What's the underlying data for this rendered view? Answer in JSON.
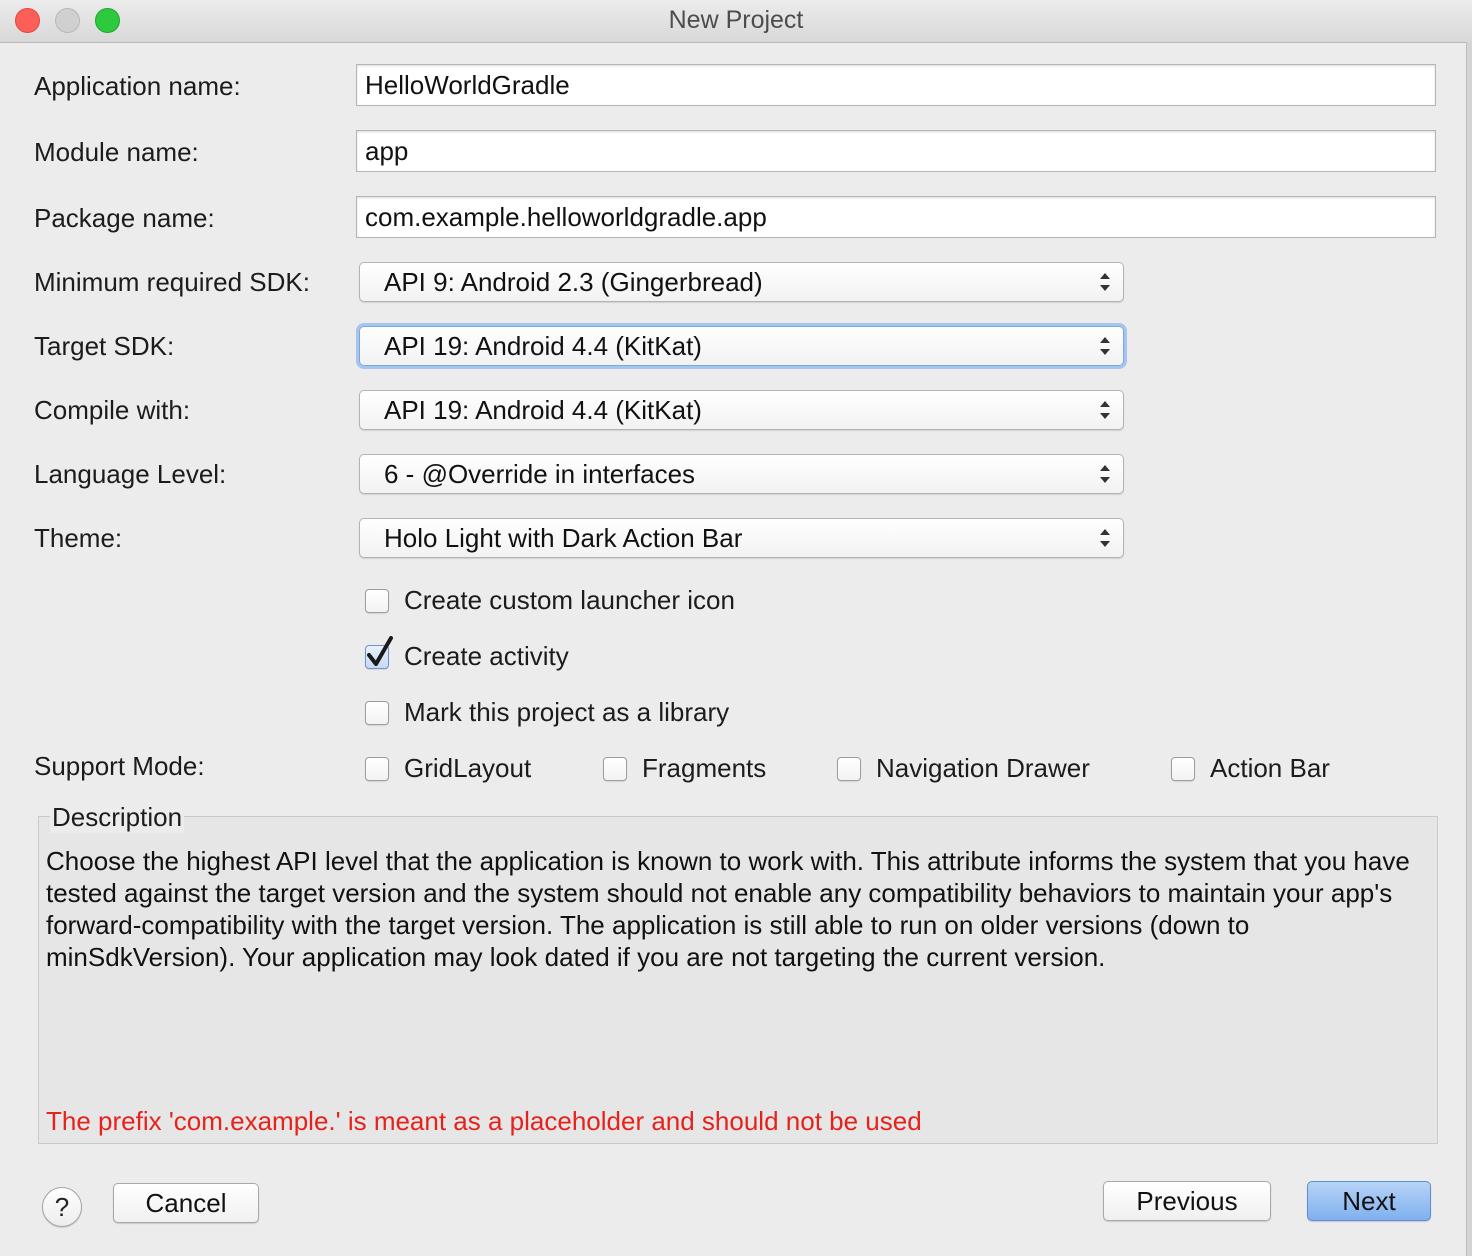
{
  "window": {
    "title": "New Project"
  },
  "form": {
    "application_name": {
      "label": "Application name:",
      "value": "HelloWorldGradle"
    },
    "module_name": {
      "label": "Module name:",
      "value": "app"
    },
    "package_name": {
      "label": "Package name:",
      "value": "com.example.helloworldgradle.app"
    },
    "min_sdk": {
      "label": "Minimum required SDK:",
      "value": "API 9: Android 2.3 (Gingerbread)"
    },
    "target_sdk": {
      "label": "Target SDK:",
      "value": "API 19: Android 4.4 (KitKat)"
    },
    "compile_with": {
      "label": "Compile with:",
      "value": "API 19: Android 4.4 (KitKat)"
    },
    "language_level": {
      "label": "Language Level:",
      "value": "6 - @Override in interfaces"
    },
    "theme": {
      "label": "Theme:",
      "value": "Holo Light with Dark Action Bar"
    }
  },
  "options": {
    "custom_launcher_icon": {
      "label": "Create custom launcher icon",
      "checked": false
    },
    "create_activity": {
      "label": "Create activity",
      "checked": true
    },
    "library": {
      "label": "Mark this project as a library",
      "checked": false
    }
  },
  "support_mode": {
    "label": "Support Mode:",
    "items": [
      {
        "label": "GridLayout",
        "checked": false
      },
      {
        "label": "Fragments",
        "checked": false
      },
      {
        "label": "Navigation Drawer",
        "checked": false
      },
      {
        "label": "Action Bar",
        "checked": false
      }
    ]
  },
  "description": {
    "title": "Description",
    "text": "Choose the highest API level that the application is known to work with. This attribute informs the system that you have tested against the target version and the system should not enable any compatibility behaviors to maintain your app's forward-compatibility with the target version. The application is still able to run on older versions (down to minSdkVersion). Your application may look dated if you are not targeting the current version.",
    "error": "The prefix 'com.example.' is meant as a placeholder and should not be used"
  },
  "buttons": {
    "help": "?",
    "cancel": "Cancel",
    "previous": "Previous",
    "next": "Next"
  },
  "colors": {
    "error": "#e5231c",
    "primary_button": "#7fb0ef",
    "focus_ring": "#a6c4f0"
  }
}
